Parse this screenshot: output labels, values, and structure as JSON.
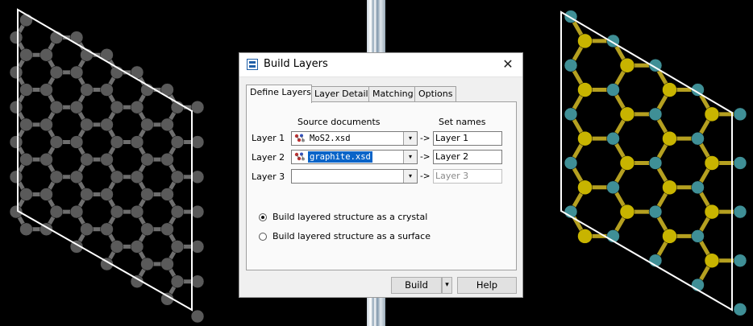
{
  "dialog": {
    "title": "Build Layers",
    "close_glyph": "✕",
    "tabs": [
      "Define Layers",
      "Layer Details",
      "Matching",
      "Options"
    ],
    "active_tab": "Define Layers",
    "headers": {
      "source": "Source documents",
      "setnames": "Set names"
    },
    "rows": [
      {
        "label": "Layer 1",
        "document": "MoS2.xsd",
        "arrow": "->",
        "set_name": "Layer 1"
      },
      {
        "label": "Layer 2",
        "document": "graphite.xsd",
        "arrow": "->",
        "set_name": "Layer 2"
      },
      {
        "label": "Layer 3",
        "document": "",
        "arrow": "->",
        "set_name": "Layer 3"
      }
    ],
    "options": [
      {
        "label": "Build layered structure as a crystal",
        "checked": true
      },
      {
        "label": "Build layered structure as a surface",
        "checked": false
      }
    ],
    "buttons": {
      "build": "Build",
      "help": "Help",
      "dropdown_glyph": "▾"
    }
  },
  "viewports": {
    "left": {
      "structure": "graphite",
      "atom_color": "#5a5a5a",
      "bond_color": "#6e6e6e",
      "cell_line_color": "#ffffff"
    },
    "right": {
      "structure": "MoS2",
      "s_color": "#c8b400",
      "mo_color": "#3f8f96",
      "cell_line_color": "#ffffff"
    }
  },
  "colors": {
    "selection": "#0a64c8",
    "dialog_bg": "#f0f0f0"
  }
}
